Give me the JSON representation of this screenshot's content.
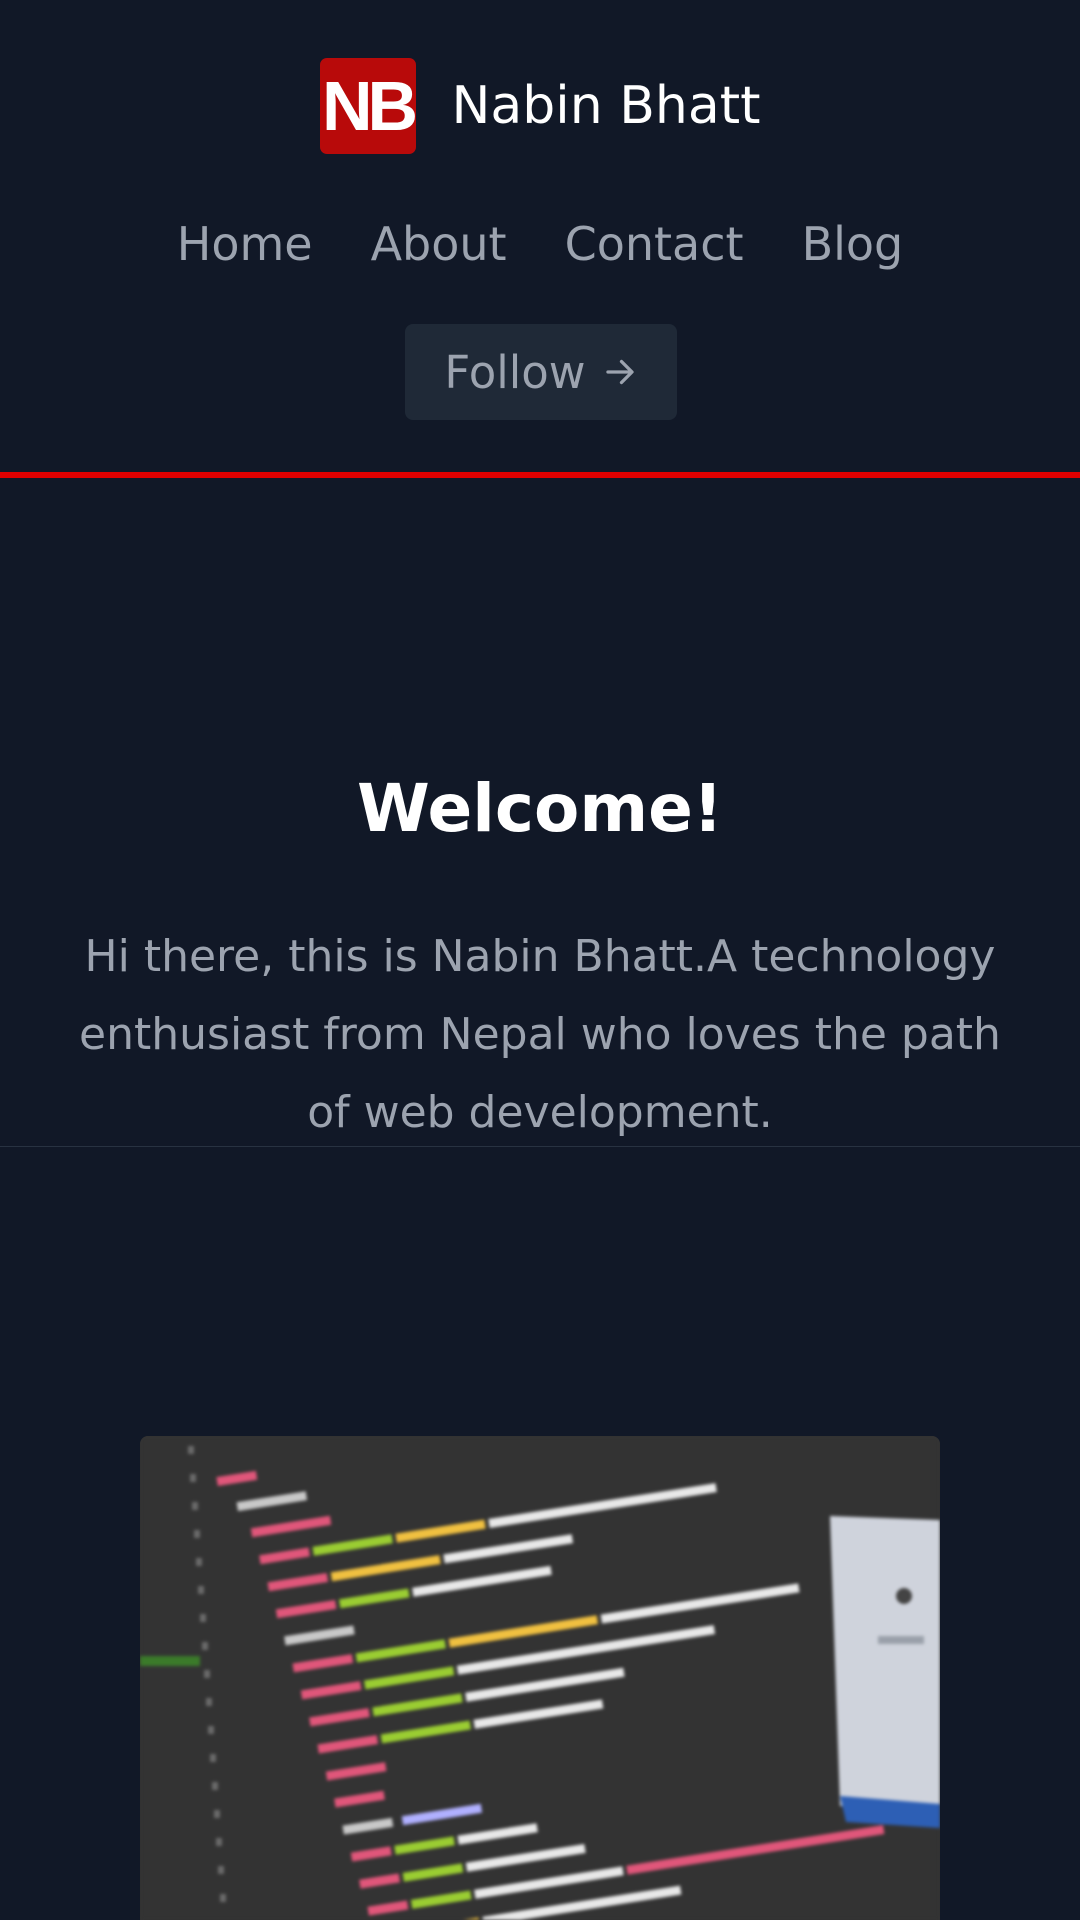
{
  "header": {
    "logo_text": "NB",
    "brand_name": "Nabin Bhatt",
    "nav": [
      {
        "label": "Home"
      },
      {
        "label": "About"
      },
      {
        "label": "Contact"
      },
      {
        "label": "Blog"
      }
    ],
    "follow_label": "Follow",
    "accent_color": "#e00000",
    "logo_color": "#b80a0a"
  },
  "hero": {
    "title": "Welcome!",
    "text": "Hi there, this is Nabin Bhatt.A technology enthusiast from Nepal who loves the path of web development."
  },
  "image": {
    "subject": "blurred photo of HTML source code on a monitor"
  },
  "icons": [
    "arrow-right-icon"
  ]
}
